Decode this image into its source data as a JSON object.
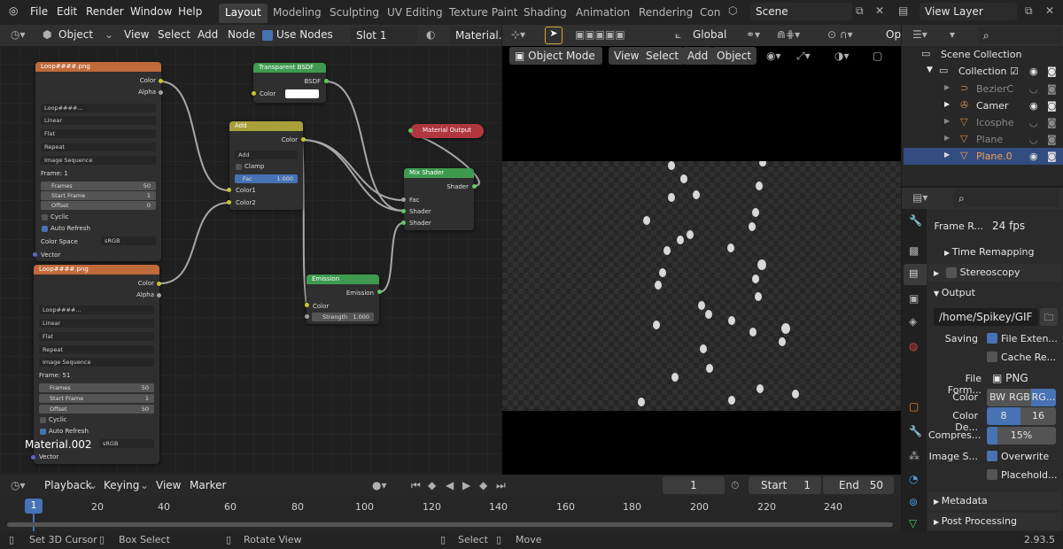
{
  "menus": [
    "File",
    "Edit",
    "Render",
    "Window",
    "Help"
  ],
  "workspaces": [
    "Layout",
    "Modeling",
    "Sculpting",
    "UV Editing",
    "Texture Paint",
    "Shading",
    "Animation",
    "Rendering",
    "Con"
  ],
  "scene": "Scene",
  "view_layer": "View Layer",
  "node_header": {
    "object": "Object",
    "view": "View",
    "select": "Select",
    "add": "Add",
    "node": "Node",
    "use_nodes": "Use Nodes",
    "slot": "Slot 1",
    "material": "Material.0"
  },
  "viewport_header": {
    "transform": "Global",
    "mode": "Object Mode",
    "view": "View",
    "select": "Select",
    "add": "Add",
    "object": "Object",
    "op": "Op"
  },
  "nodes": {
    "img1": {
      "title": "Loop####.png",
      "out_color": "Color",
      "out_alpha": "Alpha",
      "file": "Loop####...",
      "users": "2",
      "interp": "Linear",
      "proj": "Flat",
      "ext": "Repeat",
      "source": "Image Sequence",
      "frame": "Frame: 1",
      "frames_l": "Frames",
      "frames_v": "50",
      "start_l": "Start Frame",
      "start_v": "1",
      "offset_l": "Offset",
      "offset_v": "0",
      "cyclic": "Cyclic",
      "auto": "Auto Refresh",
      "cs_l": "Color Space",
      "cs_v": "sRGB",
      "vector": "Vector"
    },
    "img2": {
      "title": "Loop####.png",
      "out_color": "Color",
      "out_alpha": "Alpha",
      "file": "Loop####...",
      "users": "2",
      "interp": "Linear",
      "proj": "Flat",
      "ext": "Repeat",
      "source": "Image Sequence",
      "frame": "Frame: 51",
      "frames_l": "Frames",
      "frames_v": "50",
      "start_l": "Start Frame",
      "start_v": "1",
      "offset_l": "Offset",
      "offset_v": "50",
      "cyclic": "Cyclic",
      "auto": "Auto Refresh",
      "cs_v": "sRGB",
      "vector": "Vector"
    },
    "transparent": {
      "title": "Transparent BSDF",
      "out": "BSDF",
      "in_color": "Color"
    },
    "add": {
      "title": "Add",
      "out": "Color",
      "op": "Add",
      "clamp": "Clamp",
      "fac_l": "Fac",
      "fac_v": "1.000",
      "c1": "Color1",
      "c2": "Color2"
    },
    "matout": {
      "title": "Material Output"
    },
    "mix": {
      "title": "Mix Shader",
      "out": "Shader",
      "fac": "Fac",
      "s1": "Shader",
      "s2": "Shader"
    },
    "emission": {
      "title": "Emission",
      "out": "Emission",
      "color": "Color",
      "str_l": "Strength",
      "str_v": "1.000"
    }
  },
  "material_name": "Material.002",
  "outliner": {
    "root": "Scene Collection",
    "collection": "Collection",
    "items": [
      "BezierC",
      "Camer",
      "Icosphe",
      "Plane",
      "Plane.0"
    ]
  },
  "props": {
    "frame_rate_l": "Frame R...",
    "frame_rate_v": "24 fps",
    "time_remap": "Time Remapping",
    "stereo": "Stereoscopy",
    "output": "Output",
    "path": "/home/Spikey/GIF",
    "saving": "Saving",
    "file_ext": "File Exten...",
    "cache": "Cache Re...",
    "format_l": "File Form...",
    "format_v": "PNG",
    "color_l": "Color",
    "color_bw": "BW",
    "color_rgb": "RGB",
    "color_rgba": "RG...",
    "depth_l": "Color De...",
    "depth_8": "8",
    "depth_16": "16",
    "compress_l": "Compres...",
    "compress_v": "15%",
    "imgseq_l": "Image S...",
    "overwrite": "Overwrite",
    "placeholder": "Placehold...",
    "metadata": "Metadata",
    "post": "Post Processing"
  },
  "timeline": {
    "playback": "Playback",
    "keying": "Keying",
    "view": "View",
    "marker": "Marker",
    "current": "1",
    "start_l": "Start",
    "start_v": "1",
    "end_l": "End",
    "end_v": "50",
    "ticks": [
      "20",
      "40",
      "60",
      "80",
      "100",
      "120",
      "140",
      "160",
      "180",
      "200",
      "220",
      "240"
    ],
    "cursor": "1"
  },
  "status": {
    "a": "Set 3D Cursor",
    "b": "Box Select",
    "c": "Rotate View",
    "d": "Select",
    "e": "Move",
    "version": "2.93.5"
  },
  "colors": {
    "accent": "#4772b3",
    "image_node": "#c06a3b",
    "shader_node": "#3f9a4f",
    "converter": "#a8a03a",
    "output_node": "#b2363f"
  }
}
